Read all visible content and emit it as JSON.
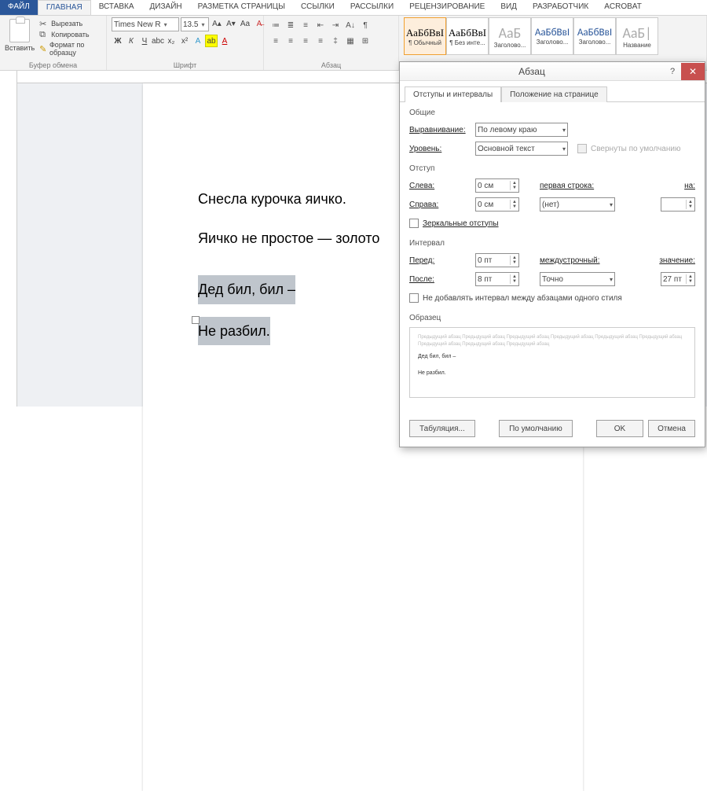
{
  "tabs": {
    "file": "ФАЙЛ",
    "home": "ГЛАВНАЯ",
    "insert": "ВСТАВКА",
    "design": "ДИЗАЙН",
    "layout": "РАЗМЕТКА СТРАНИЦЫ",
    "refs": "ССЫЛКИ",
    "mail": "РАССЫЛКИ",
    "review": "РЕЦЕНЗИРОВАНИЕ",
    "view": "ВИД",
    "dev": "РАЗРАБОТЧИК",
    "acrobat": "ACROBAT"
  },
  "clipboard": {
    "paste": "Вставить",
    "cut": "Вырезать",
    "copy": "Копировать",
    "fmt": "Формат по образцу",
    "group": "Буфер обмена"
  },
  "font": {
    "name": "Times New R",
    "size": "13.5",
    "group": "Шрифт"
  },
  "para": {
    "group": "Абзац"
  },
  "styles": {
    "s1": "¶ Обычный",
    "s2": "¶ Без инте...",
    "s3": "Заголово...",
    "s4": "Заголово...",
    "s5": "Заголово...",
    "s6": "Название",
    "prev": "АаБбВвІ",
    "prevL": "АаБ",
    "prevXL": "АаБ|"
  },
  "doc": {
    "l1": "Снесла курочка яичко.",
    "l2": "Яичко не простое — золото",
    "l3": "Дед бил, бил –",
    "l4": "Не разбил."
  },
  "dialog": {
    "title": "Абзац",
    "tab1": "Отступы и интервалы",
    "tab2": "Положение на странице",
    "sect_general": "Общие",
    "align_l": "Выравнивание:",
    "align_v": "По левому краю",
    "level_l": "Уровень:",
    "level_v": "Основной текст",
    "collapse": "Свернуты по умолчанию",
    "sect_indent": "Отступ",
    "left_l": "Слева:",
    "left_v": "0 см",
    "right_l": "Справа:",
    "right_v": "0 см",
    "first_l": "первая строка:",
    "first_v": "(нет)",
    "on_l": "на:",
    "mirror": "Зеркальные отступы",
    "sect_spacing": "Интервал",
    "before_l": "Перед:",
    "before_v": "0 пт",
    "after_l": "После:",
    "after_v": "8 пт",
    "line_l": "междустрочный:",
    "line_v": "Точно",
    "val_l": "значение:",
    "val_v": "27 пт",
    "nosame": "Не добавлять интервал между абзацами одного стиля",
    "sect_preview": "Образец",
    "tabs_btn": "Табуляция...",
    "default_btn": "По умолчанию",
    "ok": "OK",
    "cancel": "Отмена",
    "pv1": "Дед бил, бил –",
    "pv2": "Не разбил."
  }
}
